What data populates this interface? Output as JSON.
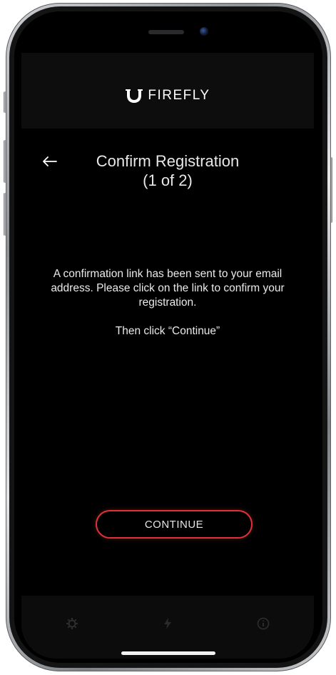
{
  "app": {
    "brand": "FIREFLY"
  },
  "screen": {
    "title_line1": "Confirm Registration",
    "title_line2": "(1 of 2)",
    "message_line1": "A confirmation link has been sent to your email address. Please click on the link to confirm your registration.",
    "message_line2": "Then click “Continue”"
  },
  "actions": {
    "continue_label": "CONTINUE"
  },
  "icons": {
    "back": "back-arrow-icon",
    "logo": "firefly-logo-icon",
    "nav_left": "gear-icon",
    "nav_center": "lightning-icon",
    "nav_right": "info-icon"
  },
  "colors": {
    "accent": "#e0303a",
    "background": "#000000",
    "header": "#0d0d0d",
    "text": "#eaeaea"
  }
}
